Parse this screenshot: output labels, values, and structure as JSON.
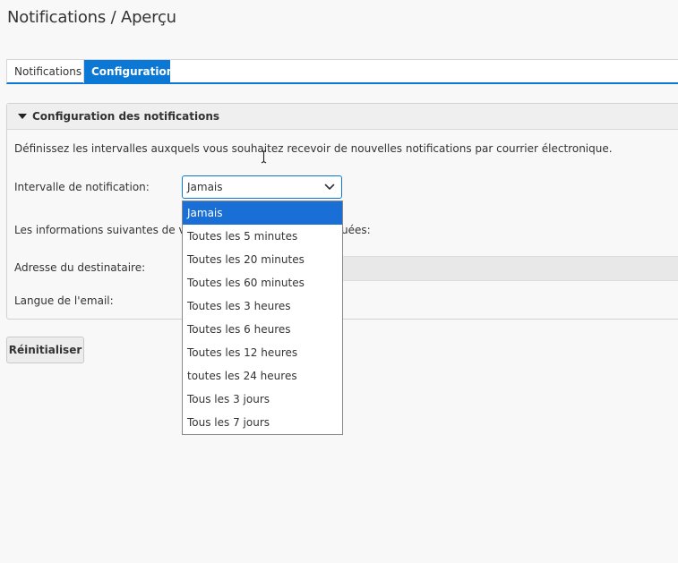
{
  "page": {
    "title": "Notifications / Aperçu"
  },
  "tabs": [
    {
      "label": "Notifications",
      "active": false
    },
    {
      "label": "Configuration",
      "active": true
    }
  ],
  "panel": {
    "title": "Configuration des notifications",
    "description": "Définissez les intervalles auxquels vous souhaitez recevoir de nouvelles notifications par courrier électronique.",
    "interval_label": "Intervalle de notification:",
    "info_text_start": "Les informations suivantes de vot",
    "info_text_end": "uées:",
    "recipient_label": "Adresse du destinataire:",
    "language_label": "Langue de l'email:"
  },
  "interval_select": {
    "value": "Jamais",
    "options": [
      "Jamais",
      "Toutes les 5 minutes",
      "Toutes les 20 minutes",
      "Toutes les 60 minutes",
      "Toutes les 3 heures",
      "Toutes les 6 heures",
      "Toutes les 12 heures",
      "toutes les 24 heures",
      "Tous les 3 jours",
      "Tous les 7 jours"
    ],
    "highlighted_index": 0
  },
  "actions": {
    "reset_label": "Réinitialiser"
  },
  "colors": {
    "accent": "#0a78d4",
    "highlight": "#1a6fd6",
    "background": "#f8f8f8"
  }
}
